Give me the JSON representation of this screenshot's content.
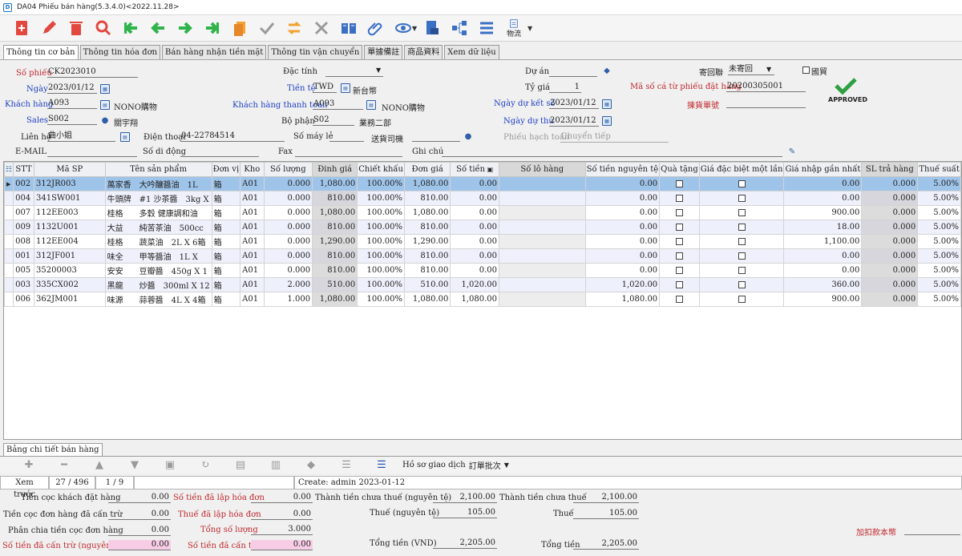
{
  "title": "DA04 Phiếu bán hàng(5.3.4.0)<2022.11.28>",
  "toolbar": {
    "logistics_label": "物流"
  },
  "tabs": [
    "Thông tin cơ bản",
    "Thông tin hóa đơn",
    "Bán hàng nhận tiền mặt",
    "Thông tin vận chuyển",
    "單據備註",
    "商品資料",
    "Xem dữ liệu"
  ],
  "form": {
    "so_phieu_label": "Số phiếu",
    "so_phieu": "CK2023010",
    "ngay_label": "Ngày",
    "ngay": "2023/01/12",
    "khach_hang_label": "Khách hàng",
    "khach_hang": "A093",
    "khach_hang_name": "NONO購物",
    "sales_label": "Sales",
    "sales": "S002",
    "sales_name": "關宇翔",
    "lien_he_label": "Liên hệ",
    "lien_he": "曲小姐",
    "email_label": "E-MAIL",
    "email": "",
    "dac_tinh_label": "Đặc tính",
    "dac_tinh": "",
    "tien_te_label": "Tiền tệ",
    "tien_te": "TWD",
    "tien_te_name": "新台幣",
    "kh_thanh_toan_label": "Khách hàng thanh toán",
    "kh_thanh_toan": "A093",
    "kh_thanh_toan_name": "NONO購物",
    "bo_phan_label": "Bộ phận",
    "bo_phan": "S02",
    "bo_phan_name": "業務二部",
    "dien_thoai_label": "Điện thoại",
    "dien_thoai": "04-22784514",
    "so_may_le_label": "Số máy lẻ",
    "so_may_le": "",
    "so_di_dong_label": "Số di động",
    "so_di_dong": "",
    "fax_label": "Fax",
    "fax": "",
    "tai_xe_label": "送貨司機",
    "tai_xe": "",
    "ghi_chu_label": "Ghi chú",
    "ghi_chu": "",
    "du_an_label": "Dự án",
    "du_an": "",
    "ty_gia_label": "Tỷ giá",
    "ty_gia": "1",
    "ngay_du_ket_so_label": "Ngày dự kết số",
    "ngay_du_ket_so": "2023/01/12",
    "ngay_du_thu_label": "Ngày dự thu",
    "ngay_du_thu": "2023/01/12",
    "phieu_hach_toan_label": "Phiếu hạch toán",
    "phieu_hach_toan": "Chuyển tiếp",
    "gui_ve_label": "寄回聯",
    "gui_ve": "未寄回",
    "quoc_te_label": "國貿",
    "ma_so_ca_tu_label": "Mã số cá từ phiếu đặt hàng",
    "ma_so_ca_tu": "20200305001",
    "pick_label": "揀貨單號",
    "pick": "",
    "approved": "APPROVED"
  },
  "grid": {
    "columns": [
      "STT",
      "Mã SP",
      "Tên sản phẩm",
      "Đơn vị",
      "Kho",
      "Số lượng",
      "Đinh giá",
      "Chiết khấu",
      "Đơn giá",
      "Số tiền",
      "Số lô hàng",
      "Số tiền nguyên tệ",
      "Quà tặng",
      "Giá đặc biệt một lần",
      "Giá nhập gần nhất",
      "SL trả hàng",
      "Thuế suất"
    ],
    "rows": [
      [
        "002",
        "312JR003",
        "萬家香　大吟釀醬油　1L",
        "箱",
        "A01",
        "0.000",
        "1,080.00",
        "100.00%",
        "1,080.00",
        "0.00",
        "",
        "0.00",
        "",
        "",
        "0.00",
        "0.000",
        "5.00%"
      ],
      [
        "004",
        "341SW001",
        "牛頭牌　#1 沙茶醬　3kg X",
        "箱",
        "A01",
        "0.000",
        "810.00",
        "100.00%",
        "810.00",
        "0.00",
        "",
        "0.00",
        "",
        "",
        "0.00",
        "0.000",
        "5.00%"
      ],
      [
        "007",
        "112EE003",
        "桂格　　多穀 健康調和油",
        "箱",
        "A01",
        "0.000",
        "1,080.00",
        "100.00%",
        "1,080.00",
        "0.00",
        "",
        "0.00",
        "",
        "",
        "900.00",
        "0.000",
        "5.00%"
      ],
      [
        "009",
        "1132U001",
        "大益　　純苦茶油　500cc",
        "箱",
        "A01",
        "0.000",
        "810.00",
        "100.00%",
        "810.00",
        "0.00",
        "",
        "0.00",
        "",
        "",
        "18.00",
        "0.000",
        "5.00%"
      ],
      [
        "008",
        "112EE004",
        "桂格　　蔬菜油　2L X 6箱",
        "箱",
        "A01",
        "0.000",
        "1,290.00",
        "100.00%",
        "1,290.00",
        "0.00",
        "",
        "0.00",
        "",
        "",
        "1,100.00",
        "0.000",
        "5.00%"
      ],
      [
        "001",
        "312JF001",
        "味全　　甲等醬油　1L X",
        "箱",
        "A01",
        "0.000",
        "810.00",
        "100.00%",
        "810.00",
        "0.00",
        "",
        "0.00",
        "",
        "",
        "0.00",
        "0.000",
        "5.00%"
      ],
      [
        "005",
        "35200003",
        "安安　　豆瓣醬　450g X 1",
        "箱",
        "A01",
        "0.000",
        "810.00",
        "100.00%",
        "810.00",
        "0.00",
        "",
        "0.00",
        "",
        "",
        "0.00",
        "0.000",
        "5.00%"
      ],
      [
        "003",
        "335CX002",
        "黑龍　　炒醬　300ml X 12",
        "箱",
        "A01",
        "2.000",
        "510.00",
        "100.00%",
        "510.00",
        "1,020.00",
        "",
        "1,020.00",
        "",
        "",
        "360.00",
        "0.000",
        "5.00%"
      ],
      [
        "006",
        "362JM001",
        "味源　　蒜蓉醬　4L X 4箱",
        "箱",
        "A01",
        "1.000",
        "1,080.00",
        "100.00%",
        "1,080.00",
        "1,080.00",
        "",
        "1,080.00",
        "",
        "",
        "900.00",
        "0.000",
        "5.00%"
      ]
    ]
  },
  "section_tab": "Bảng chi tiết bán hàng",
  "subbar": {
    "ho_so_label": "Hồ sơ giao dịch",
    "batch_label": "訂單批次"
  },
  "nav": {
    "prev_label": "Xem trước",
    "record": "27 / 496",
    "page": "1 / 9",
    "created": "Create: admin 2023-01-12"
  },
  "totals": {
    "tien_coc_kh_label": "Tiền cọc khách đặt hàng",
    "tien_coc_kh": "0.00",
    "tien_coc_can_tru_label": "Tiền cọc đơn hàng đã cấn trừ",
    "tien_coc_can_tru": "0.00",
    "phan_chia_label": "Phân chia tiền cọc đơn hàng",
    "phan_chia": "0.00",
    "so_tien_can_tru_nt_label": "Số tiền đã cấn trừ (nguyên tệ)",
    "so_tien_can_tru_nt": "0.00",
    "so_tien_lap_hd_label": "Số tiền đã lập hóa đơn",
    "so_tien_lap_hd": "0.00",
    "thue_lap_hd_label": "Thuế đã lập hóa đơn",
    "thue_lap_hd": "0.00",
    "tong_so_luong_label": "Tổng số lượng",
    "tong_so_luong": "3.000",
    "so_tien_can_tru_label": "Số tiền đã cấn trừ",
    "so_tien_can_tru": "0.00",
    "thanh_tien_chua_thue_nt_label": "Thành tiền chưa thuế (nguyên tệ)",
    "thanh_tien_chua_thue_nt": "2,100.00",
    "thue_nt_label": "Thuế (nguyên tệ)",
    "thue_nt": "105.00",
    "tong_tien_vnd_label": "Tổng tiền (VND)",
    "tong_tien_vnd": "2,205.00",
    "thanh_tien_chua_thue_label": "Thành tiền chưa thuế",
    "thanh_tien_chua_thue": "2,100.00",
    "thue_label": "Thuế",
    "thue": "105.00",
    "tong_tien_label": "Tổng tiền",
    "tong_tien": "2,205.00",
    "add_deduct_label": "加扣款本幣",
    "add_deduct": ""
  }
}
